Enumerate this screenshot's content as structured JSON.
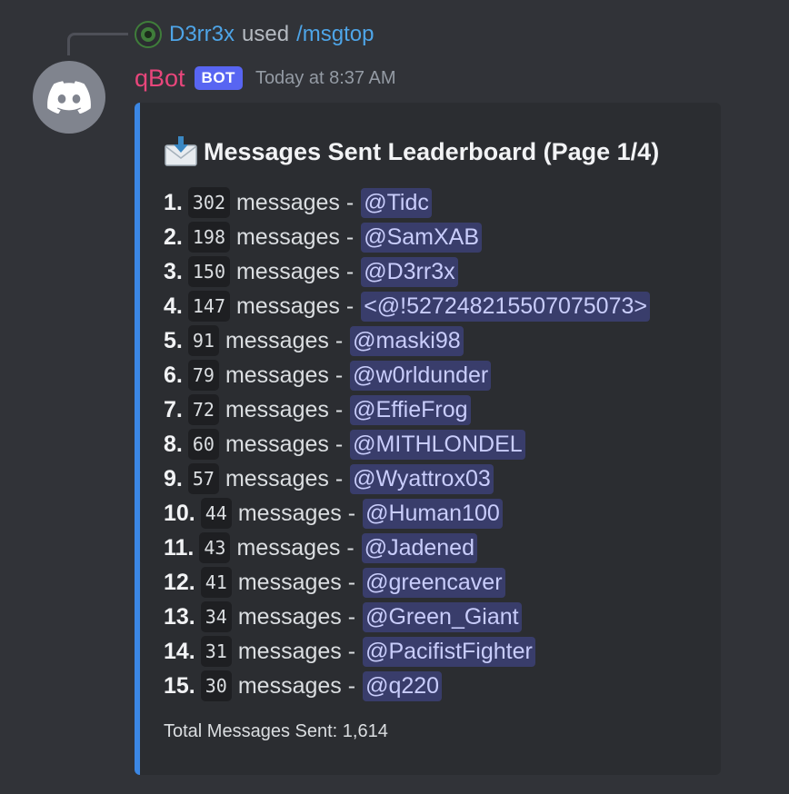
{
  "reply": {
    "username": "D3rr3x",
    "used_text": "used",
    "command": "/msgtop"
  },
  "message": {
    "author": "qBot",
    "bot_tag": "BOT",
    "timestamp": "Today at 8:37 AM"
  },
  "embed": {
    "accent_color": "#3b87e4",
    "title_icon": "envelope-with-arrow",
    "title": "Messages Sent Leaderboard (Page 1/4)",
    "messages_word": "messages -",
    "rows": [
      {
        "rank": "1.",
        "count": "302",
        "user": "@Tidc"
      },
      {
        "rank": "2.",
        "count": "198",
        "user": "@SamXAB"
      },
      {
        "rank": "3.",
        "count": "150",
        "user": "@D3rr3x"
      },
      {
        "rank": "4.",
        "count": "147",
        "user": "<@!527248215507075073>"
      },
      {
        "rank": "5.",
        "count": "91",
        "user": "@maski98"
      },
      {
        "rank": "6.",
        "count": "79",
        "user": "@w0rldunder"
      },
      {
        "rank": "7.",
        "count": "72",
        "user": "@EffieFrog"
      },
      {
        "rank": "8.",
        "count": "60",
        "user": "@MITHLONDEL"
      },
      {
        "rank": "9.",
        "count": "57",
        "user": "@Wyattrox03"
      },
      {
        "rank": "10.",
        "count": "44",
        "user": "@Human100"
      },
      {
        "rank": "11.",
        "count": "43",
        "user": "@Jadened"
      },
      {
        "rank": "12.",
        "count": "41",
        "user": "@greencaver"
      },
      {
        "rank": "13.",
        "count": "34",
        "user": "@Green_Giant"
      },
      {
        "rank": "14.",
        "count": "31",
        "user": "@PacifistFighter"
      },
      {
        "rank": "15.",
        "count": "30",
        "user": "@q220"
      }
    ],
    "footer": "Total Messages Sent: 1,614"
  }
}
